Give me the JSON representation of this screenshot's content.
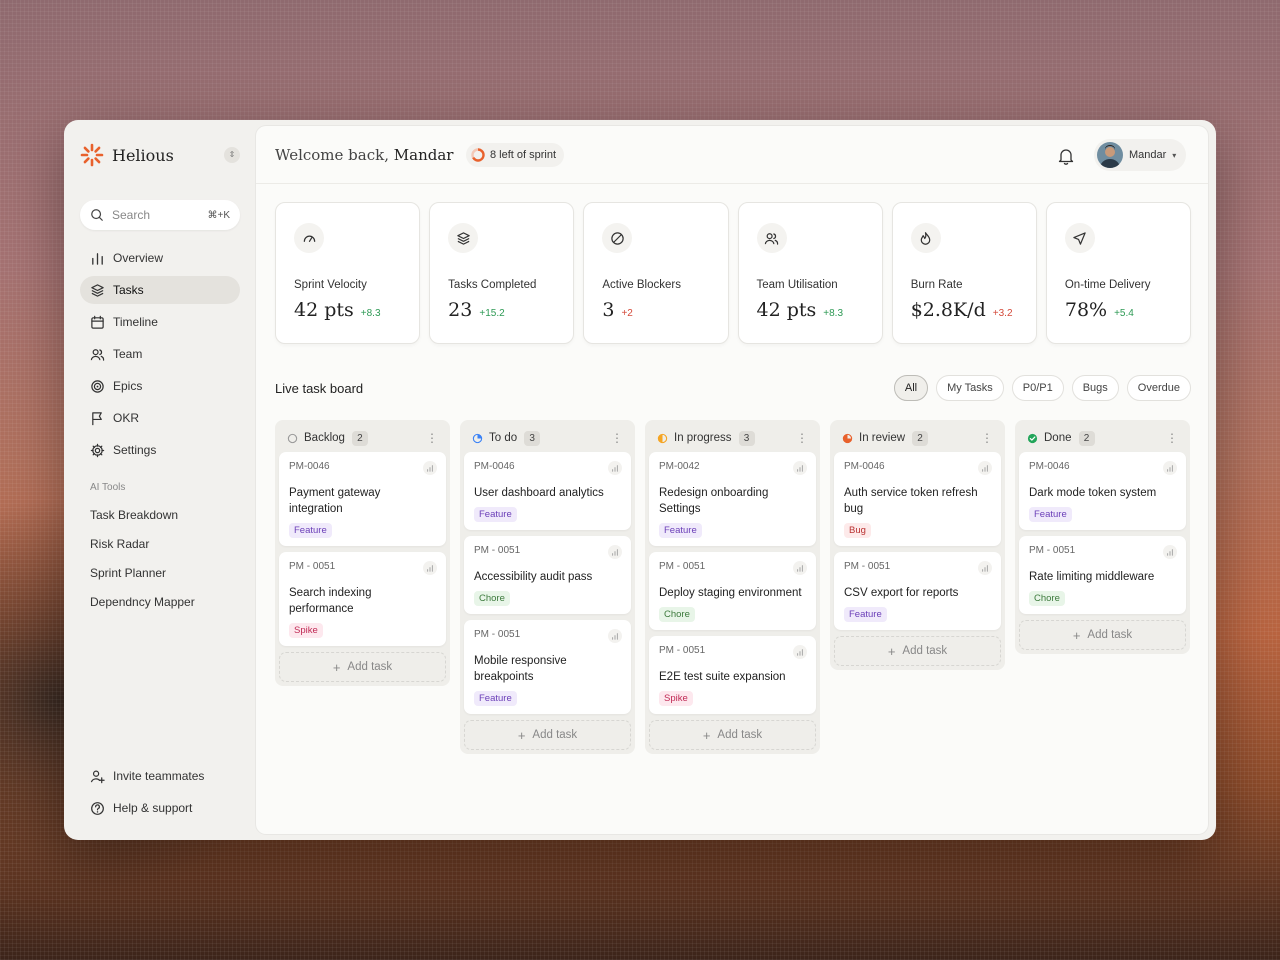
{
  "brand": {
    "name": "Helious",
    "accent": "#e8612c"
  },
  "search": {
    "placeholder": "Search",
    "shortcut": "⌘+K"
  },
  "nav": [
    {
      "label": "Overview",
      "icon": "bar-chart-icon",
      "active": false
    },
    {
      "label": "Tasks",
      "icon": "layers-icon",
      "active": true
    },
    {
      "label": "Timeline",
      "icon": "calendar-icon",
      "active": false
    },
    {
      "label": "Team",
      "icon": "users-icon",
      "active": false
    },
    {
      "label": "Epics",
      "icon": "target-icon",
      "active": false
    },
    {
      "label": "OKR",
      "icon": "flag-icon",
      "active": false
    },
    {
      "label": "Settings",
      "icon": "gear-icon",
      "active": false
    }
  ],
  "ai_tools": {
    "label": "AI Tools",
    "items": [
      "Task Breakdown",
      "Risk Radar",
      "Sprint Planner",
      "Dependncy Mapper"
    ]
  },
  "bottom_nav": [
    {
      "label": "Invite teammates",
      "icon": "user-plus-icon"
    },
    {
      "label": "Help & support",
      "icon": "help-circle-icon"
    }
  ],
  "header": {
    "welcome": "Welcome back,",
    "user_name": "Mandar",
    "sprint_pill": "8 left of sprint",
    "account_name": "Mandar"
  },
  "kpis": [
    {
      "label": "Sprint Velocity",
      "value": "42 pts",
      "delta": "+8.3",
      "trend": "pos",
      "icon": "gauge-icon"
    },
    {
      "label": "Tasks Completed",
      "value": "23",
      "delta": "+15.2",
      "trend": "pos",
      "icon": "layers-icon"
    },
    {
      "label": "Active Blockers",
      "value": "3",
      "delta": "+2",
      "trend": "neg",
      "icon": "blocked-icon"
    },
    {
      "label": "Team Utilisation",
      "value": "42 pts",
      "delta": "+8.3",
      "trend": "pos",
      "icon": "users-icon"
    },
    {
      "label": "Burn Rate",
      "value": "$2.8K/d",
      "delta": "+3.2",
      "trend": "neg",
      "icon": "flame-icon"
    },
    {
      "label": "On-time Delivery",
      "value": "78%",
      "delta": "+5.4",
      "trend": "pos",
      "icon": "send-icon"
    }
  ],
  "board": {
    "title": "Live task board",
    "filters": [
      {
        "label": "All",
        "active": true
      },
      {
        "label": "My Tasks",
        "active": false
      },
      {
        "label": "P0/P1",
        "active": false
      },
      {
        "label": "Bugs",
        "active": false
      },
      {
        "label": "Overdue",
        "active": false
      }
    ],
    "add_task_label": "Add task",
    "columns": [
      {
        "name": "Backlog",
        "count": "2",
        "status": "backlog",
        "color": "#9a9a9a",
        "cards": [
          {
            "id": "PM-0046",
            "title": "Payment gateway integration",
            "tag": "Feature",
            "tag_type": "feature"
          },
          {
            "id": "PM - 0051",
            "title": "Search indexing performance",
            "tag": "Spike",
            "tag_type": "spike"
          }
        ]
      },
      {
        "name": "To do",
        "count": "3",
        "status": "todo",
        "color": "#3b82f6",
        "cards": [
          {
            "id": "PM-0046",
            "title": "User dashboard analytics",
            "tag": "Feature",
            "tag_type": "feature"
          },
          {
            "id": "PM - 0051",
            "title": "Accessibility audit pass",
            "tag": "Chore",
            "tag_type": "chore"
          },
          {
            "id": "PM - 0051",
            "title": "Mobile responsive breakpoints",
            "tag": "Feature",
            "tag_type": "feature"
          }
        ]
      },
      {
        "name": "In progress",
        "count": "3",
        "status": "progress",
        "color": "#f5a524",
        "cards": [
          {
            "id": "PM-0042",
            "title": "Redesign onboarding Settings",
            "tag": "Feature",
            "tag_type": "feature"
          },
          {
            "id": "PM - 0051",
            "title": "Deploy staging environment",
            "tag": "Chore",
            "tag_type": "chore"
          },
          {
            "id": "PM - 0051",
            "title": "E2E test suite expansion",
            "tag": "Spike",
            "tag_type": "spike"
          }
        ]
      },
      {
        "name": "In review",
        "count": "2",
        "status": "review",
        "color": "#e8612c",
        "cards": [
          {
            "id": "PM-0046",
            "title": "Auth service token refresh bug",
            "tag": "Bug",
            "tag_type": "bug"
          },
          {
            "id": "PM - 0051",
            "title": "CSV export for reports",
            "tag": "Feature",
            "tag_type": "feature"
          }
        ]
      },
      {
        "name": "Done",
        "count": "2",
        "status": "done",
        "color": "#22a55a",
        "cards": [
          {
            "id": "PM-0046",
            "title": "Dark mode token system",
            "tag": "Feature",
            "tag_type": "feature"
          },
          {
            "id": "PM - 0051",
            "title": "Rate limiting middleware",
            "tag": "Chore",
            "tag_type": "chore"
          }
        ]
      }
    ]
  }
}
